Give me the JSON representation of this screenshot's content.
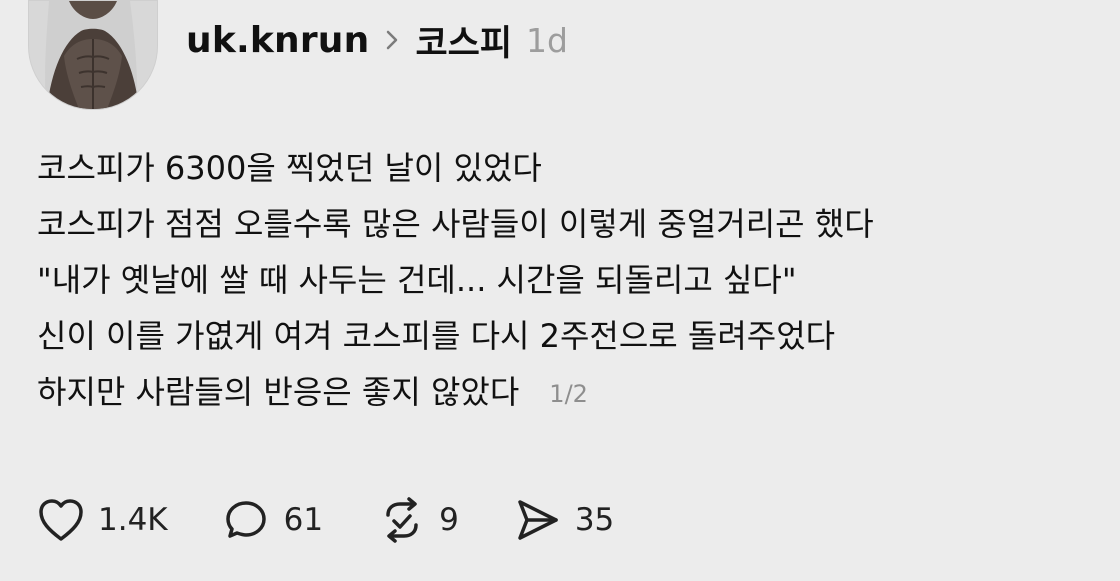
{
  "author": {
    "username": "uk.knrun",
    "avatar_icon": "profile-photo"
  },
  "community": {
    "name": "코스피",
    "separator_icon": "chevron-right-icon"
  },
  "post": {
    "age": "1d",
    "lines": [
      "코스피가 6300을 찍었던 날이 있었다",
      "코스피가 점점 오를수록 많은 사람들이 이렇게 중얼거리곤 했다",
      "\"내가 옛날에 쌀 때 사두는 건데... 시간을 되돌리고 싶다\"",
      "신이 이를 가엾게 여겨 코스피를 다시 2주전으로 돌려주었다",
      "하지만 사람들의 반응은 좋지 않았다"
    ],
    "pagination": "1/2"
  },
  "actions": {
    "like": {
      "icon": "heart-icon",
      "count": "1.4K"
    },
    "comment": {
      "icon": "comment-icon",
      "count": "61"
    },
    "repost": {
      "icon": "repost-icon",
      "count": "9"
    },
    "share": {
      "icon": "send-icon",
      "count": "35"
    }
  },
  "colors": {
    "background": "#ececec",
    "text": "#111111",
    "muted": "#9d9d9d"
  }
}
